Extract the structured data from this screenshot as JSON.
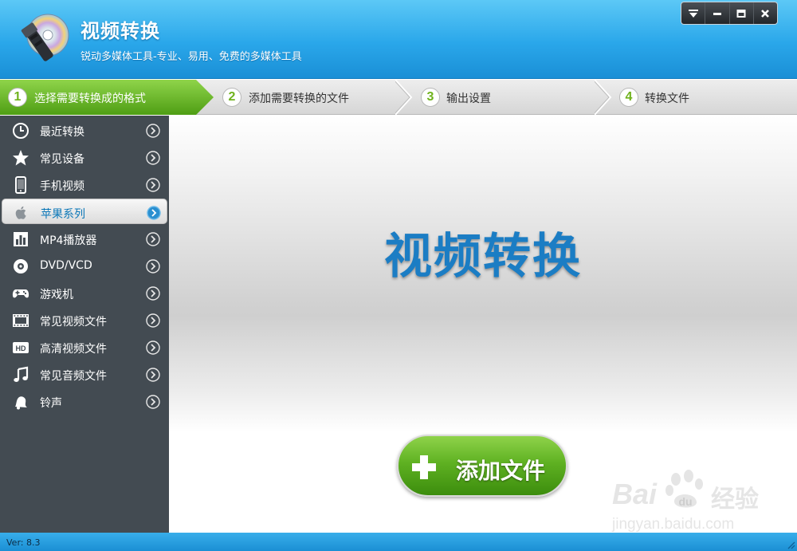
{
  "app": {
    "title": "视频转换",
    "subtitle": "锐动多媒体工具-专业、易用、免费的多媒体工具"
  },
  "window_controls": [
    {
      "icon": "dropdown-icon"
    },
    {
      "icon": "minimize-icon"
    },
    {
      "icon": "maximize-icon"
    },
    {
      "icon": "close-icon"
    }
  ],
  "steps": [
    {
      "num": "1",
      "label": "选择需要转换成的格式",
      "active": true
    },
    {
      "num": "2",
      "label": "添加需要转换的文件",
      "active": false
    },
    {
      "num": "3",
      "label": "输出设置",
      "active": false
    },
    {
      "num": "4",
      "label": "转换文件",
      "active": false
    }
  ],
  "sidebar": {
    "items": [
      {
        "label": "最近转换",
        "icon": "clock-icon"
      },
      {
        "label": "常见设备",
        "icon": "star-icon"
      },
      {
        "label": "手机视频",
        "icon": "phone-icon"
      },
      {
        "label": "苹果系列",
        "icon": "apple-icon",
        "selected": true
      },
      {
        "label": "MP4播放器",
        "icon": "mp4-player-icon"
      },
      {
        "label": "DVD/VCD",
        "icon": "disc-icon"
      },
      {
        "label": "游戏机",
        "icon": "gamepad-icon"
      },
      {
        "label": "常见视频文件",
        "icon": "film-icon"
      },
      {
        "label": "高清视频文件",
        "icon": "hd-icon"
      },
      {
        "label": "常见音频文件",
        "icon": "music-note-icon"
      },
      {
        "label": "铃声",
        "icon": "bell-icon"
      }
    ]
  },
  "main": {
    "title": "视频转换",
    "add_button_label": "添加文件"
  },
  "watermark": {
    "brand_left": "Bai",
    "brand_right": "经验",
    "url": "jingyan.baidu.com"
  },
  "status": {
    "version": "Ver: 8.3"
  },
  "colors": {
    "header_blue": "#2aa7ea",
    "sidebar_bg": "#434b52",
    "active_step_green": "#63b21f",
    "title_blue": "#1b7dc4",
    "add_button_green": "#5fb122"
  }
}
